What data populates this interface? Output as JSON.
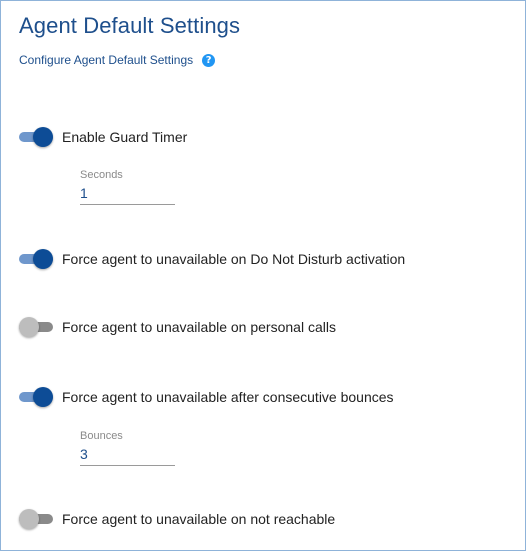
{
  "header": {
    "title": "Agent Default Settings",
    "subtitle": "Configure Agent Default Settings",
    "help_icon": "?"
  },
  "settings": [
    {
      "label": "Enable Guard Timer",
      "enabled": true
    },
    {
      "label": "Force agent to unavailable on Do Not Disturb activation",
      "enabled": true
    },
    {
      "label": "Force agent to unavailable on personal calls",
      "enabled": false
    },
    {
      "label": "Force agent to unavailable after consecutive bounces",
      "enabled": true
    },
    {
      "label": "Force agent to unavailable on not reachable",
      "enabled": false
    }
  ],
  "fields": {
    "seconds": {
      "label": "Seconds",
      "value": "1"
    },
    "bounces": {
      "label": "Bounces",
      "value": "3"
    }
  },
  "colors": {
    "title": "#1e4f8c",
    "toggle_on_knob": "#0d4c96",
    "toggle_on_track": "#6f97cc",
    "toggle_off_knob": "#bdbdbd",
    "toggle_off_track": "#8a8a8a",
    "help_icon": "#2196f3"
  }
}
